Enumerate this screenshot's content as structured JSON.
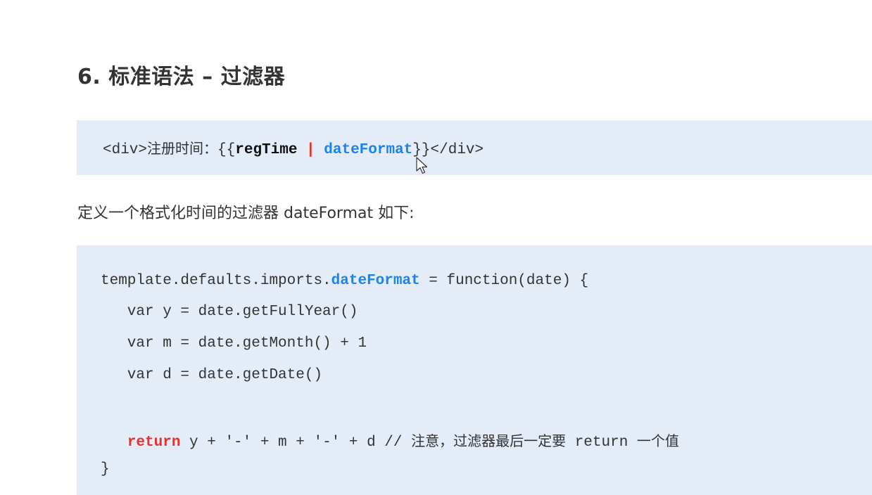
{
  "heading": "6. 标准语法 – 过滤器",
  "snippet1": {
    "open_tag": "<div>",
    "label": "注册时间：",
    "braces_open": "{{",
    "var": "regTime",
    "pipe": " | ",
    "filter": "dateFormat",
    "braces_close": "}}",
    "close_tag": "</div>"
  },
  "paragraph": "定义一个格式化时间的过滤器 dateFormat 如下:",
  "snippet2": {
    "line1_prefix": "template.defaults.imports.",
    "line1_name": "dateFormat",
    "line1_suffix": " = function(date) {",
    "line2": "   var y = date.getFullYear()",
    "line3": "   var m = date.getMonth() + 1",
    "line4": "   var d = date.getDate()",
    "line5_indent": "   ",
    "line5_keyword": "return",
    "line5_expr": " y + '-' + m + '-' + d // ",
    "line5_comment_cjk1": "注意，过滤器最后一定要",
    "line5_comment_return": " return ",
    "line5_comment_cjk2": "一个值",
    "line6": "}"
  },
  "colors": {
    "code_background": "#e4ecf8",
    "keyword_red": "#e8312b",
    "identifier_blue": "#1a84ee"
  }
}
